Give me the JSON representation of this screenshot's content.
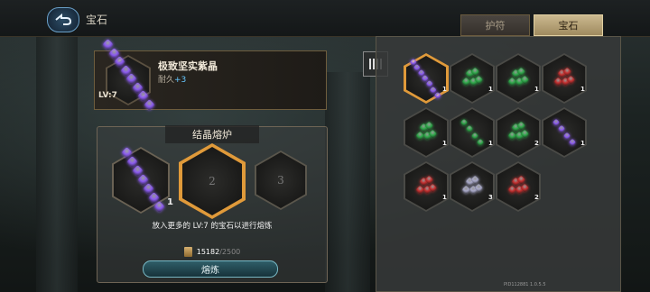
{
  "header": {
    "title": "宝石",
    "back_icon": "back-arrow-icon"
  },
  "tabs": [
    {
      "label": "护符",
      "active": false
    },
    {
      "label": "宝石",
      "active": true
    }
  ],
  "selected_gem": {
    "name": "极致坚实紫晶",
    "durability_label": "耐久",
    "durability_bonus": "+3",
    "level": "LV:7"
  },
  "forge": {
    "title": "结晶熔炉",
    "slots": [
      {
        "label": "",
        "count": "1",
        "filled": true
      },
      {
        "label": "2",
        "count": "",
        "filled": false
      },
      {
        "label": "3",
        "count": "",
        "filled": false
      }
    ],
    "hint": "放入更多的 LV:7 的宝石以进行熔炼",
    "cost_current": "15182",
    "cost_max": "/2500",
    "button_label": "熔炼"
  },
  "inventory": [
    {
      "color": "#8c5cf0",
      "kind": "column",
      "count": "1",
      "selected": true
    },
    {
      "color": "#2fa84a",
      "kind": "cluster",
      "count": "1"
    },
    {
      "color": "#2fa84a",
      "kind": "cluster",
      "count": "1"
    },
    {
      "color": "#c43030",
      "kind": "cluster",
      "count": "1"
    },
    {
      "color": "#2fa84a",
      "kind": "cluster",
      "count": "1"
    },
    {
      "color": "#2fa84a",
      "kind": "diag",
      "count": "1"
    },
    {
      "color": "#2fa84a",
      "kind": "cluster",
      "count": "2"
    },
    {
      "color": "#8c5cf0",
      "kind": "diag",
      "count": "1"
    },
    {
      "color": "#c43030",
      "kind": "cluster",
      "count": "1"
    },
    {
      "color": "#a8a8c8",
      "kind": "cluster",
      "count": "3"
    },
    {
      "color": "#c43030",
      "kind": "cluster",
      "count": "2"
    }
  ],
  "version": "PID112881  1.0.5.5",
  "colors": {
    "accent_gold": "#e09a3a",
    "amethyst": "#8c5cf0"
  }
}
